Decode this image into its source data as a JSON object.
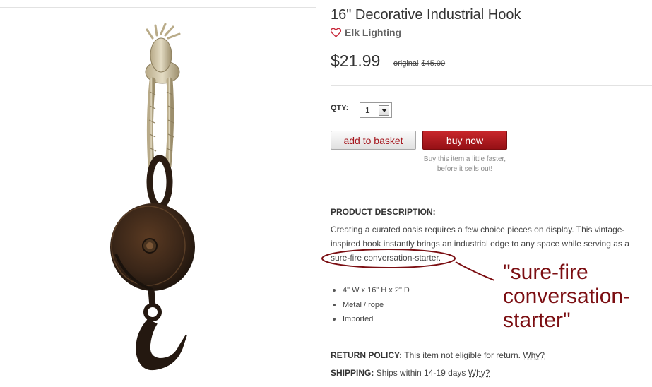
{
  "product": {
    "title": "16\" Decorative Industrial Hook",
    "brand": "Elk Lighting",
    "price": "$21.99",
    "original_label": "original",
    "original_price": "$45.00"
  },
  "purchase": {
    "qty_label": "QTY:",
    "qty_value": "1",
    "add_to_basket": "add to basket",
    "buy_now": "buy now",
    "buy_note": "Buy this item a little faster, before it sells out!"
  },
  "description": {
    "heading": "PRODUCT DESCRIPTION:",
    "text": "Creating a curated oasis requires a few choice pieces on display. This vintage-inspired hook instantly brings an industrial edge to any space while serving as a sure-fire conversation-starter.",
    "bullets": [
      "4\" W x 16\" H x 2\" D",
      "Metal / rope",
      "Imported"
    ]
  },
  "callout": {
    "line1": "\"sure-fire",
    "line2": "conversation-",
    "line3": "starter\""
  },
  "policies": {
    "return_label": "RETURN POLICY:",
    "return_text": "This item not eligible for return.",
    "return_link": "Why?",
    "shipping_label": "SHIPPING:",
    "shipping_text": "Ships within 14-19 days",
    "shipping_link": "Why?"
  },
  "colors": {
    "accent_red": "#a4141b",
    "annotation_red": "#7b0e12",
    "heart_red": "#c8283a"
  }
}
